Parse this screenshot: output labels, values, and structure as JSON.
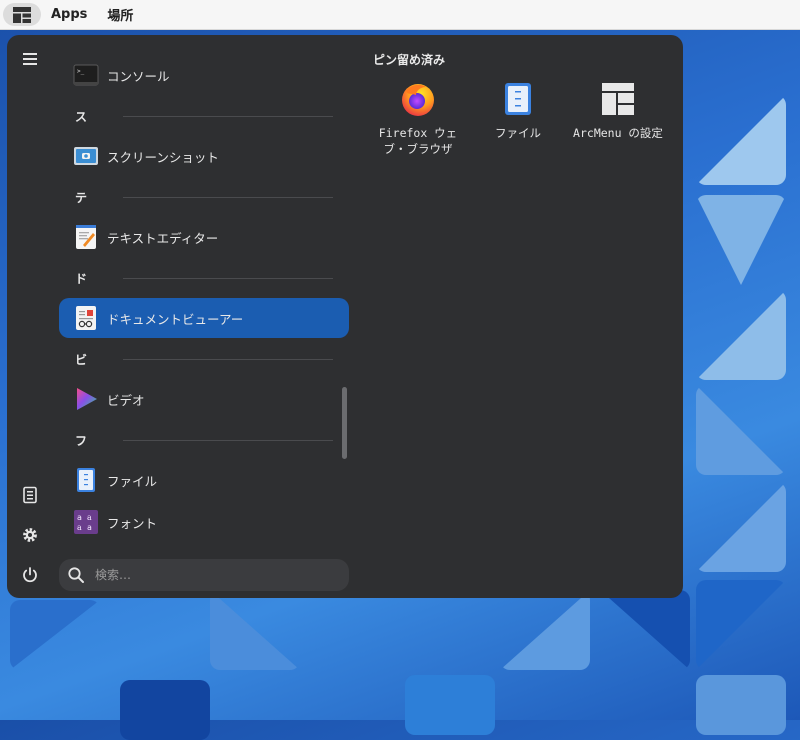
{
  "topbar": {
    "apps_label": "Apps",
    "places_label": "場所"
  },
  "menu": {
    "pinned_title": "ピン留め済み",
    "pinned": [
      {
        "label": "Firefox ウェブ・ブラウザ",
        "icon": "firefox-icon"
      },
      {
        "label": "ファイル",
        "icon": "files-icon"
      },
      {
        "label": "ArcMenu の設定",
        "icon": "arcmenu-settings-icon"
      }
    ],
    "apps": [
      {
        "label": "コンソール",
        "icon": "console-icon"
      },
      {
        "header": "ス"
      },
      {
        "label": "スクリーンショット",
        "icon": "screenshot-icon"
      },
      {
        "header": "テ"
      },
      {
        "label": "テキストエディター",
        "icon": "text-editor-icon"
      },
      {
        "header": "ド"
      },
      {
        "label": "ドキュメントビューアー",
        "icon": "document-viewer-icon",
        "selected": true
      },
      {
        "header": "ビ"
      },
      {
        "label": "ビデオ",
        "icon": "video-icon"
      },
      {
        "header": "フ"
      },
      {
        "label": "ファイル",
        "icon": "files-icon"
      },
      {
        "label": "フォント",
        "icon": "fonts-icon"
      }
    ],
    "search_placeholder": "検索…",
    "side_icons": [
      "hamburger-menu-icon",
      "documents-icon",
      "settings-icon",
      "power-icon"
    ]
  },
  "colors": {
    "panel_bg": "#2e2f31",
    "selected": "#1b5db1",
    "topbar_bg": "#f6f6f6"
  }
}
